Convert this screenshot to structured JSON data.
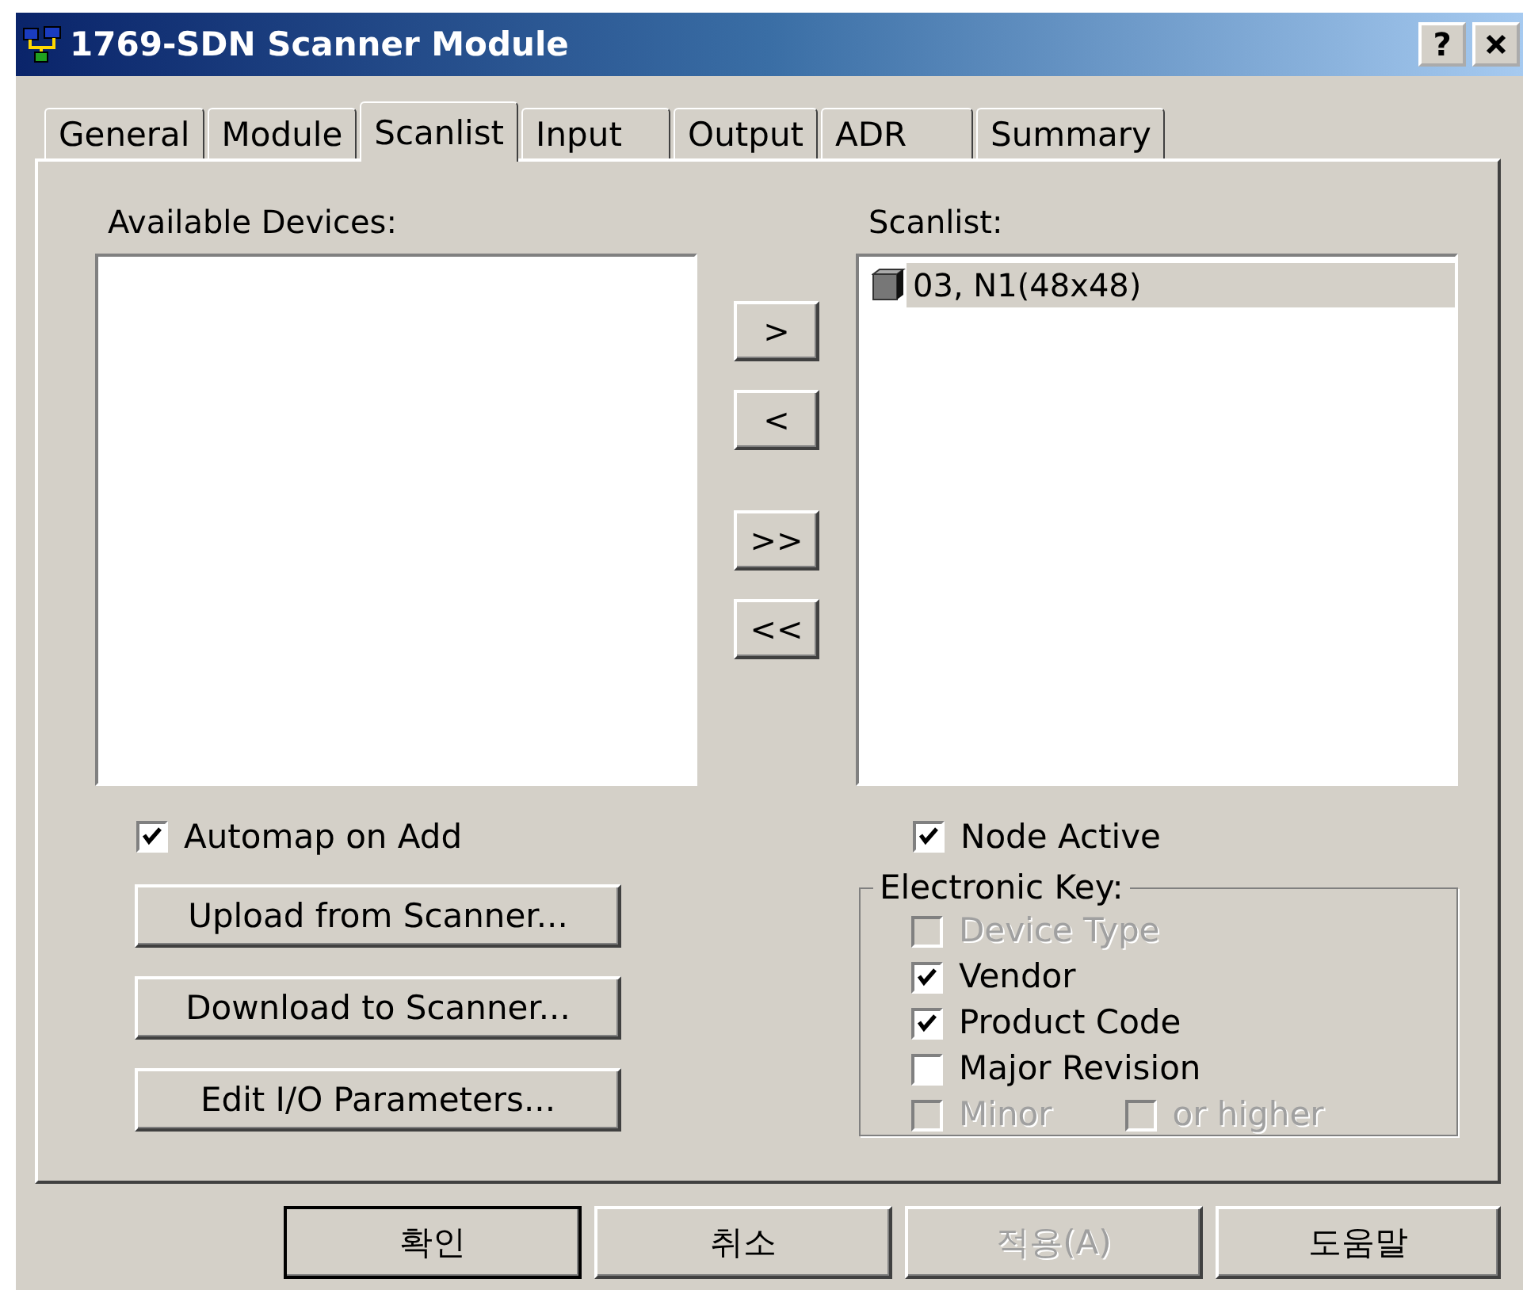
{
  "window": {
    "title": "1769-SDN Scanner Module",
    "help_button": "?"
  },
  "tabs": [
    {
      "label": "General",
      "selected": false
    },
    {
      "label": "Module",
      "selected": false
    },
    {
      "label": "Scanlist",
      "selected": true
    },
    {
      "label": "Input",
      "selected": false
    },
    {
      "label": "Output",
      "selected": false
    },
    {
      "label": "ADR",
      "selected": false
    },
    {
      "label": "Summary",
      "selected": false
    }
  ],
  "available_devices": {
    "label": "Available Devices:"
  },
  "move_buttons": [
    ">",
    "<",
    ">>",
    "<<"
  ],
  "scanlist": {
    "label": "Scanlist:",
    "items": [
      {
        "text": "03, N1(48x48)",
        "selected": true
      }
    ]
  },
  "automap": {
    "label": "Automap on Add",
    "checked": true
  },
  "left_buttons": [
    "Upload from Scanner...",
    "Download to Scanner...",
    "Edit I/O Parameters..."
  ],
  "node_active": {
    "label": "Node Active",
    "checked": true
  },
  "electronic_key": {
    "label": "Electronic Key:",
    "rows": [
      {
        "options": [
          {
            "label": "Device Type",
            "checked": false,
            "disabled": true
          }
        ]
      },
      {
        "options": [
          {
            "label": "Vendor",
            "checked": true,
            "disabled": false
          }
        ]
      },
      {
        "options": [
          {
            "label": "Product Code",
            "checked": true,
            "disabled": false
          }
        ]
      },
      {
        "options": [
          {
            "label": "Major Revision",
            "checked": false,
            "disabled": false
          }
        ]
      },
      {
        "options": [
          {
            "label": "Minor",
            "checked": false,
            "disabled": true
          },
          {
            "label": "or higher",
            "checked": false,
            "disabled": true
          }
        ]
      }
    ]
  },
  "dialog_buttons": [
    {
      "label": "확인",
      "disabled": false,
      "default": true
    },
    {
      "label": "취소",
      "disabled": false,
      "default": false
    },
    {
      "label": "적용(A)",
      "disabled": true,
      "default": false
    },
    {
      "label": "도움말",
      "disabled": false,
      "default": false
    }
  ]
}
